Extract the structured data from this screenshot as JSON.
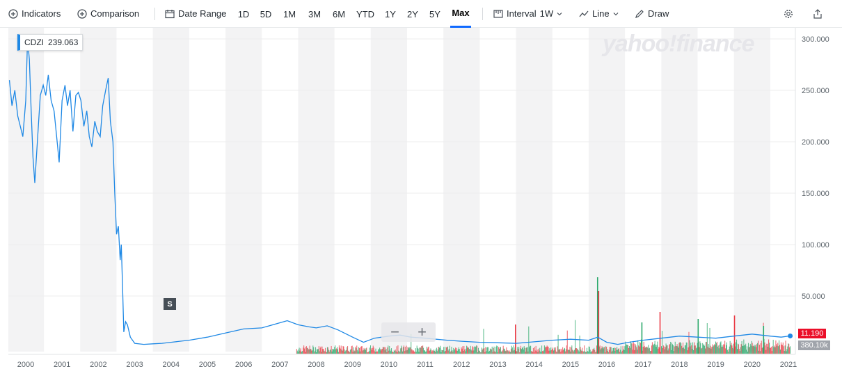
{
  "toolbar": {
    "indicators": "Indicators",
    "comparison": "Comparison",
    "date_range": "Date Range",
    "ranges": [
      "1D",
      "5D",
      "1M",
      "3M",
      "6M",
      "YTD",
      "1Y",
      "2Y",
      "5Y",
      "Max"
    ],
    "active_range": "Max",
    "interval_label": "Interval",
    "interval_value": "1W",
    "line_label": "Line",
    "draw_label": "Draw"
  },
  "watermark": "yahoo!finance",
  "tooltip": {
    "symbol": "CDZI",
    "value": "239.063"
  },
  "zoom": {
    "minus": "−",
    "plus": "+"
  },
  "split_marker": "S",
  "price_tag": "11.190",
  "volume_tag": "380.10k",
  "colors": {
    "line": "#1e88e5",
    "up_volume": "#2aa86a",
    "down_volume": "#ea3943",
    "band": "#f3f3f4"
  },
  "chart_data": {
    "type": "line",
    "symbol": "CDZI",
    "x_range": [
      2000.0,
      2021.1
    ],
    "y_range": [
      0,
      300
    ],
    "yticks": [
      "50.000",
      "100.000",
      "150.000",
      "200.000",
      "250.000",
      "300.000"
    ],
    "ytick_values": [
      50,
      100,
      150,
      200,
      250,
      300
    ],
    "xticks": [
      "2000",
      "2001",
      "2002",
      "2003",
      "2004",
      "2005",
      "2006",
      "2007",
      "2008",
      "2009",
      "2010",
      "2011",
      "2012",
      "2013",
      "2014",
      "2015",
      "2016",
      "2017",
      "2018",
      "2019",
      "2020",
      "2021"
    ],
    "xtick_values": [
      2000,
      2001,
      2002,
      2003,
      2004,
      2005,
      2006,
      2007,
      2008,
      2009,
      2010,
      2011,
      2012,
      2013,
      2014,
      2015,
      2016,
      2017,
      2018,
      2019,
      2020,
      2021
    ],
    "series": [
      {
        "values": [
          [
            1999.55,
            260
          ],
          [
            1999.62,
            235
          ],
          [
            1999.7,
            250
          ],
          [
            1999.78,
            225
          ],
          [
            1999.85,
            215
          ],
          [
            1999.92,
            205
          ],
          [
            2000.0,
            240
          ],
          [
            2000.05,
            300
          ],
          [
            2000.1,
            280
          ],
          [
            2000.15,
            230
          ],
          [
            2000.2,
            185
          ],
          [
            2000.25,
            160
          ],
          [
            2000.32,
            200
          ],
          [
            2000.4,
            245
          ],
          [
            2000.48,
            255
          ],
          [
            2000.55,
            245
          ],
          [
            2000.62,
            265
          ],
          [
            2000.7,
            240
          ],
          [
            2000.78,
            230
          ],
          [
            2000.85,
            205
          ],
          [
            2000.92,
            180
          ],
          [
            2001.0,
            240
          ],
          [
            2001.08,
            255
          ],
          [
            2001.15,
            235
          ],
          [
            2001.22,
            250
          ],
          [
            2001.3,
            210
          ],
          [
            2001.38,
            245
          ],
          [
            2001.45,
            248
          ],
          [
            2001.52,
            240
          ],
          [
            2001.6,
            215
          ],
          [
            2001.68,
            230
          ],
          [
            2001.75,
            205
          ],
          [
            2001.82,
            195
          ],
          [
            2001.9,
            220
          ],
          [
            2001.97,
            210
          ],
          [
            2002.05,
            205
          ],
          [
            2002.12,
            235
          ],
          [
            2002.2,
            250
          ],
          [
            2002.27,
            262
          ],
          [
            2002.33,
            220
          ],
          [
            2002.4,
            200
          ],
          [
            2002.45,
            150
          ],
          [
            2002.5,
            110
          ],
          [
            2002.55,
            118
          ],
          [
            2002.6,
            85
          ],
          [
            2002.63,
            100
          ],
          [
            2002.67,
            55
          ],
          [
            2002.7,
            15
          ],
          [
            2002.75,
            25
          ],
          [
            2002.8,
            22
          ],
          [
            2002.88,
            10
          ],
          [
            2003.0,
            4
          ],
          [
            2003.25,
            3
          ],
          [
            2003.5,
            3.5
          ],
          [
            2003.75,
            4
          ],
          [
            2004.0,
            5
          ],
          [
            2004.5,
            7
          ],
          [
            2005.0,
            10
          ],
          [
            2005.5,
            14
          ],
          [
            2006.0,
            18
          ],
          [
            2006.5,
            19
          ],
          [
            2007.0,
            24
          ],
          [
            2007.2,
            26
          ],
          [
            2007.5,
            22
          ],
          [
            2007.8,
            20
          ],
          [
            2008.0,
            19
          ],
          [
            2008.3,
            21
          ],
          [
            2008.6,
            17
          ],
          [
            2009.0,
            10
          ],
          [
            2009.3,
            5
          ],
          [
            2009.6,
            9
          ],
          [
            2010.0,
            11
          ],
          [
            2010.3,
            12
          ],
          [
            2010.6,
            10
          ],
          [
            2011.0,
            9
          ],
          [
            2011.3,
            8
          ],
          [
            2011.6,
            7
          ],
          [
            2012.0,
            6
          ],
          [
            2012.5,
            5
          ],
          [
            2013.0,
            4.5
          ],
          [
            2013.5,
            4
          ],
          [
            2014.0,
            5.5
          ],
          [
            2014.5,
            7
          ],
          [
            2015.0,
            8
          ],
          [
            2015.5,
            7
          ],
          [
            2015.75,
            10
          ],
          [
            2016.0,
            5
          ],
          [
            2016.3,
            3
          ],
          [
            2016.6,
            5
          ],
          [
            2017.0,
            7
          ],
          [
            2017.5,
            9
          ],
          [
            2018.0,
            11
          ],
          [
            2018.5,
            10
          ],
          [
            2019.0,
            9
          ],
          [
            2019.5,
            11
          ],
          [
            2020.0,
            13
          ],
          [
            2020.5,
            11
          ],
          [
            2020.8,
            10
          ],
          [
            2021.05,
            11.19
          ]
        ]
      }
    ]
  }
}
